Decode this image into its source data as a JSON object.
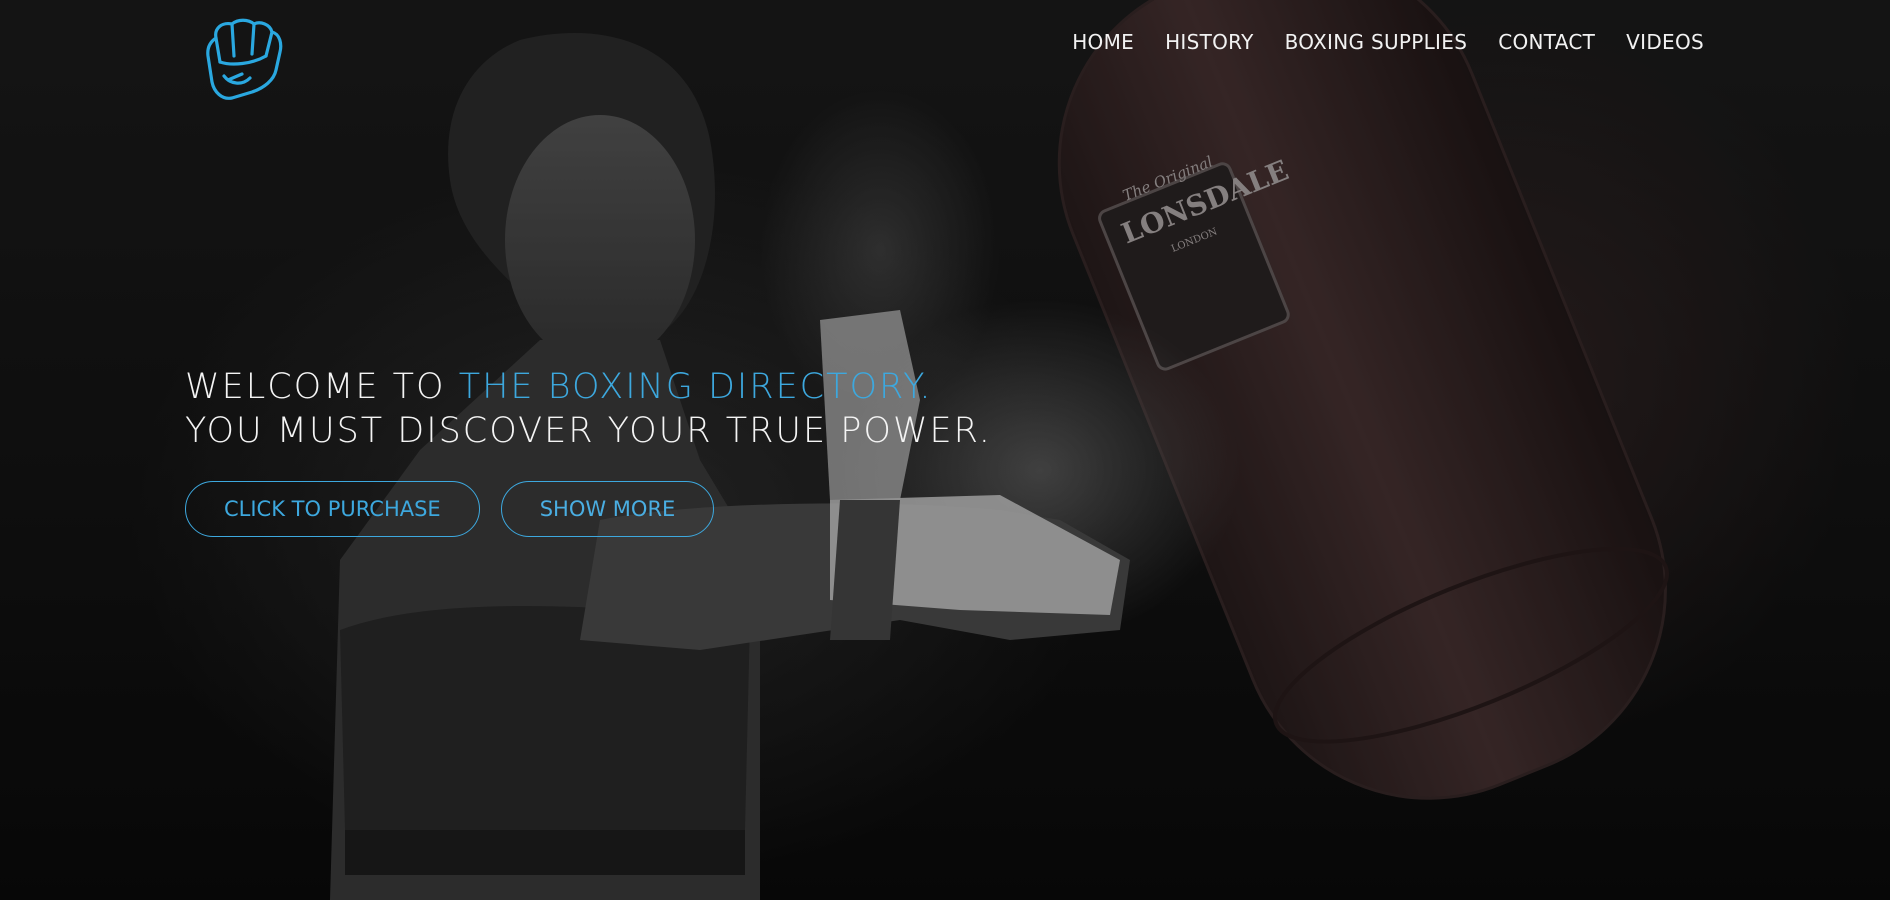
{
  "header": {
    "logo": {
      "icon": "fist-icon",
      "color": "#2aa8e0"
    },
    "nav": [
      {
        "label": "HOME"
      },
      {
        "label": "HISTORY"
      },
      {
        "label": "BOXING SUPPLIES"
      },
      {
        "label": "CONTACT"
      },
      {
        "label": "VIDEOS"
      }
    ]
  },
  "hero": {
    "line1_prefix": "WELCOME TO ",
    "line1_accent": "THE BOXING DIRECTORY.",
    "line2": "YOU MUST DISCOVER YOUR TRUE POWER.",
    "buttons": {
      "purchase": "CLICK TO PURCHASE",
      "more": "SHOW MORE"
    },
    "background": {
      "description_icon": "boxer-punching-bag-photo",
      "bag_brand": "LONSDALE",
      "bag_tagline": "The Original",
      "bag_city": "LONDON"
    }
  },
  "colors": {
    "accent": "#3da8de",
    "text": "#f4f4f4",
    "background": "#141414"
  }
}
